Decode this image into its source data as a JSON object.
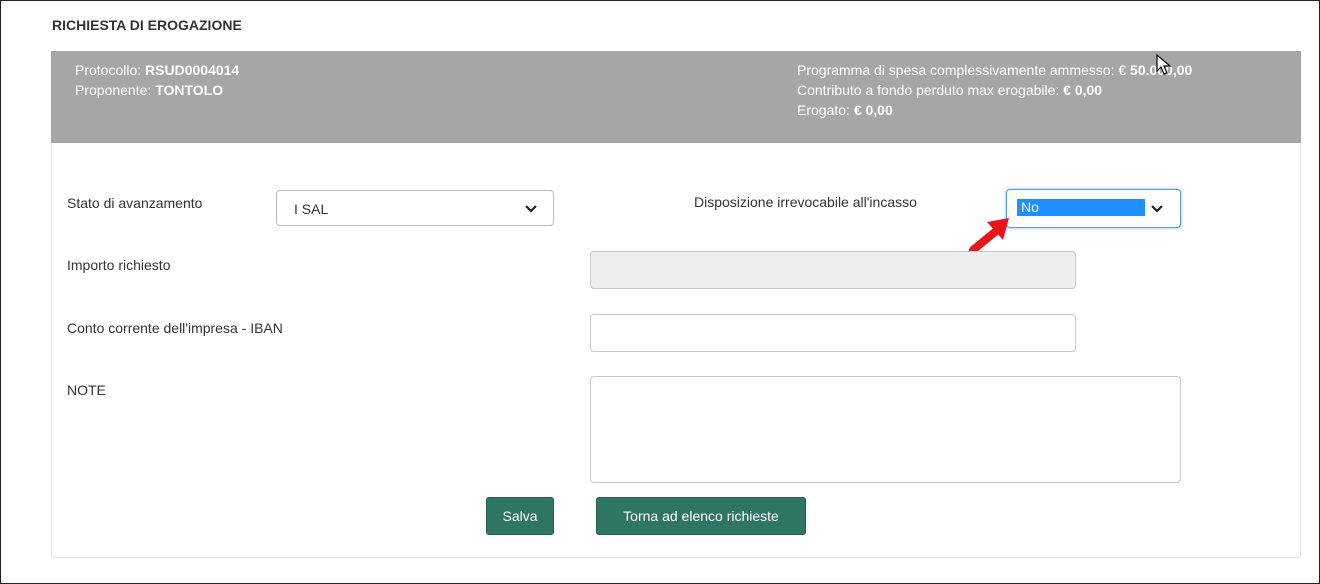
{
  "page": {
    "title": "RICHIESTA DI EROGAZIONE"
  },
  "header": {
    "protocollo_label": "Protocollo:",
    "protocollo_value": "RSUD0004014",
    "proponente_label": "Proponente:",
    "proponente_value": "TONTOLO",
    "programma_label": "Programma di spesa complessivamente ammesso: €",
    "programma_value": "50.000,00",
    "contributo_label": "Contributo a fondo perduto max erogabile:",
    "contributo_value": "€ 0,00",
    "erogato_label": "Erogato:",
    "erogato_value": "€ 0,00"
  },
  "form": {
    "stato_label": "Stato di avanzamento",
    "stato_value": "I SAL",
    "disposizione_label": "Disposizione irrevocabile all'incasso",
    "disposizione_value": "No",
    "importo_label": "Importo richiesto",
    "importo_value": "",
    "iban_label": "Conto corrente dell'impresa - IBAN",
    "iban_value": "",
    "note_label": "NOTE",
    "note_value": ""
  },
  "buttons": {
    "salva": "Salva",
    "torna": "Torna ad elenco richieste"
  },
  "colors": {
    "header_bg": "#a6a6a6",
    "button_bg": "#2e7563",
    "selection_bg": "#1e90ff",
    "annotation_red": "#e8141b"
  },
  "icons": {
    "dropdown": "chevron-down-icon",
    "cursor": "mouse-pointer-icon",
    "annotation": "red-dotted-arrow-icon"
  }
}
